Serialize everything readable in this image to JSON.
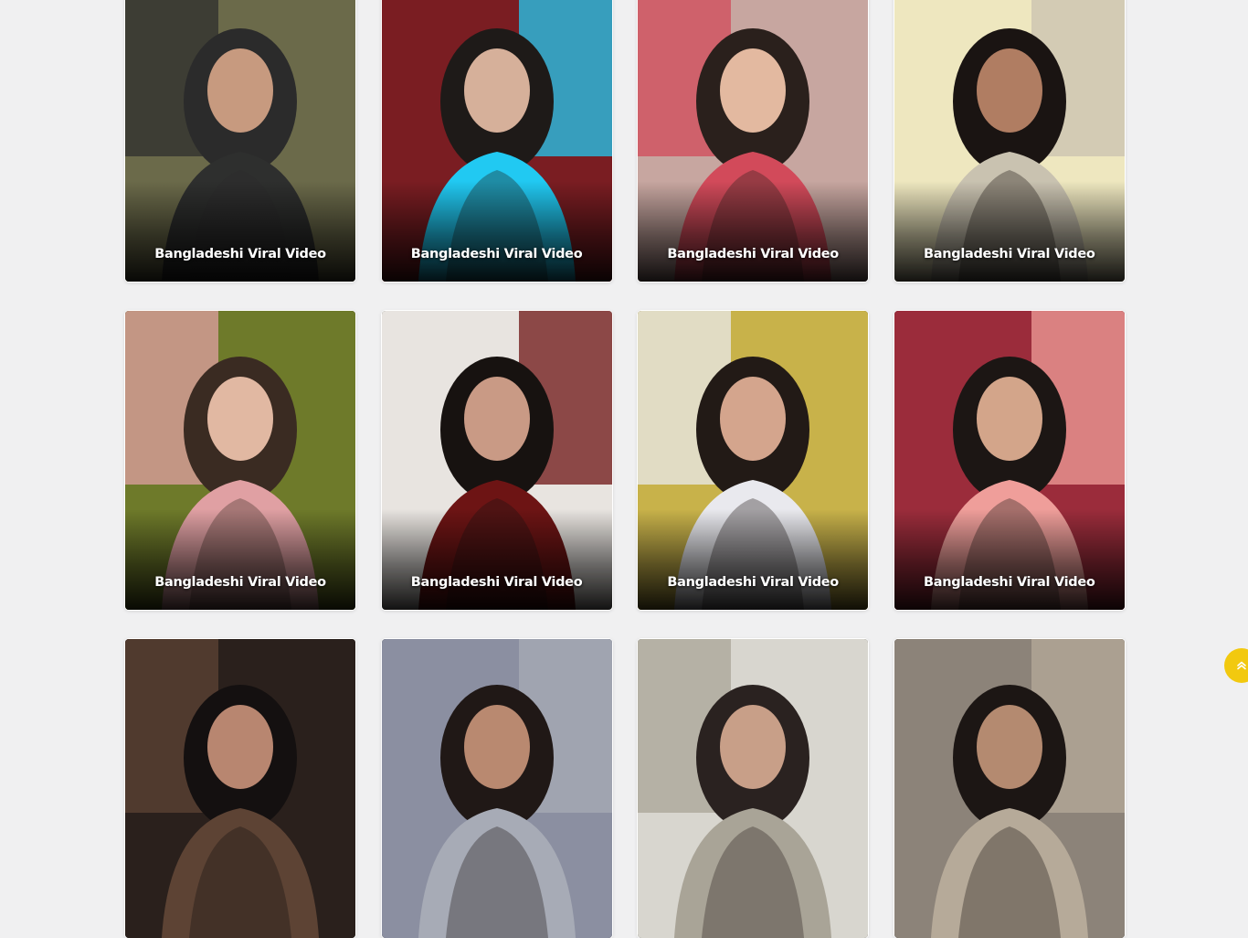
{
  "cards": [
    {
      "title": "Bangladeshi Viral Video",
      "bg": "#6b6a4a",
      "accent": "#2e2f2e",
      "skin": "#c79a7f",
      "hair": "#2b2b2b"
    },
    {
      "title": "Bangladeshi Viral Video",
      "bg": "#7a1d22",
      "accent": "#21c9f2",
      "skin": "#d6b09a",
      "hair": "#1e1a18"
    },
    {
      "title": "Bangladeshi Viral Video",
      "bg": "#c7a6a0",
      "accent": "#d24a5a",
      "skin": "#e3b9a0",
      "hair": "#2a201c"
    },
    {
      "title": "Bangladeshi Viral Video",
      "bg": "#eee7bf",
      "accent": "#c9c2b0",
      "skin": "#b07d62",
      "hair": "#1a1412"
    },
    {
      "title": "Bangladeshi Viral Video",
      "bg": "#6e7a2a",
      "accent": "#e0a0a3",
      "skin": "#e1b8a2",
      "hair": "#3a2b22"
    },
    {
      "title": "Bangladeshi Viral Video",
      "bg": "#e8e4e0",
      "accent": "#6d1414",
      "skin": "#c99a85",
      "hair": "#171210"
    },
    {
      "title": "Bangladeshi Viral Video",
      "bg": "#c8b24a",
      "accent": "#e9e9ee",
      "skin": "#d4a58d",
      "hair": "#221a16"
    },
    {
      "title": "Bangladeshi Viral Video",
      "bg": "#9b2c3b",
      "accent": "#ef9e9a",
      "skin": "#d3a58a",
      "hair": "#1c1614"
    },
    {
      "title": "",
      "bg": "#2a201c",
      "accent": "#5d4334",
      "skin": "#b88670",
      "hair": "#141010"
    },
    {
      "title": "",
      "bg": "#8b8fa1",
      "accent": "#a7abb6",
      "skin": "#b98970",
      "hair": "#201816"
    },
    {
      "title": "",
      "bg": "#d8d6cf",
      "accent": "#a9a497",
      "skin": "#c89f88",
      "hair": "#2a2220"
    },
    {
      "title": "",
      "bg": "#8c8379",
      "accent": "#b6aa99",
      "skin": "#b48a70",
      "hair": "#1c1614"
    }
  ],
  "scroll_top": {
    "icon": "double-chevron-up-icon",
    "color": "#f2c90f"
  }
}
